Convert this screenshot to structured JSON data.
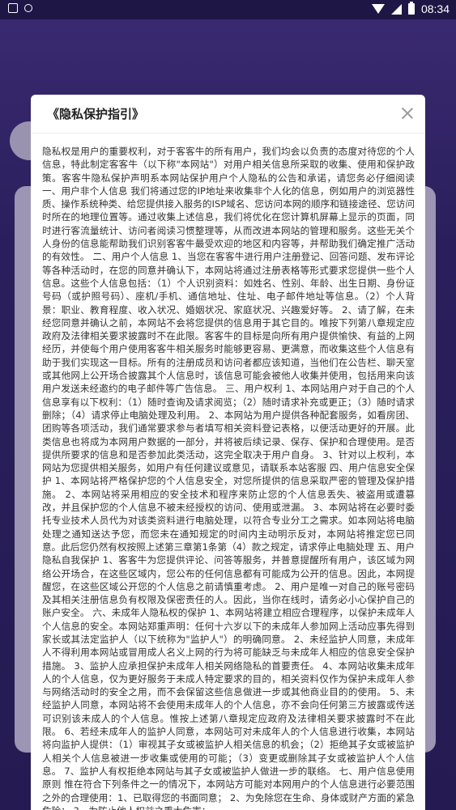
{
  "status_bar": {
    "time": "08:34",
    "icons": [
      "notification-icon",
      "sync-icon",
      "wifi-icon",
      "signal-icon",
      "battery-icon"
    ]
  },
  "dialog": {
    "title": "《隐私保护指引》",
    "close_icon": "close-icon",
    "body": "隐私权是用户的重要权利，对于客客牛的所有用户，我们均会以负责的态度对待您的个人信息，特此制定客客牛（以下称\"本网站\"）对用户相关信息所采取的收集、使用和保护政策。客客牛隐私保护声明系本网站保护用户个人隐私的公告和承诺，请您务必仔细阅读 一、用户非个人信息 我们将通过您的IP地址来收集非个人化的信息，例如用户的浏览器性质、操作系统种类、给您提供接入服务的ISP域名、您访问本网的顺序和链接途径、您访问时所在的地理位置等。通过收集上述信息，我们将优化在您计算机屏幕上显示的页面，同时进行客流量统计、访问者阅读习惯整理等，从而改进本网站的管理和服务。这些无关个人身份的信息能帮助我们识别客客牛最受欢迎的地区和内容等，并帮助我们确定推广活动的有效性。 二、用户个人信息 1、当您在客客牛进行用户注册登记、回答问题、发布评论等各种活动时，在您的同意并确认下，本网站将通过注册表格等形式要求您提供一些个人信息。这些个人信息包括：（1）个人识别资料：如姓名、性别、年龄、出生日期、身份证号码（或护照号码）、座机/手机、通信地址、住址、电子邮件地址等信息。（2）个人背景：职业、教育程度、收入状况、婚姻状况、家庭状况、兴趣爱好等。 2、请了解，在未经您同意并确认之前，本网站不会将您提供的信息用于其它目的。唯按下列第八章规定应政府及法律相关要求披露时不在此限。客客牛的目标是向所有用户提供愉快、有益的上网经历，并使每个用户使用客客牛相关服务时能够更容易、更满意，而收集这些个人信息有助于我们实现这一目标。所有的注册成员和访问者都应该知道，当他们在公告栏、聊天室或其他网上公开场合披露其个人信息时，该信息可能会被他人收集并使用，包括用来向该用户发送未经邀约的电子邮件等广告信息。 三、用户权利 1、本网站用户对于自己的个人信息享有以下权利：（1）随时查询及请求阅览；（2）随时请求补充或更正；（3）随时请求删除；（4）请求停止电脑处理及利用。 2、本网站为用户提供各种配套服务，如看房团、团购等各项活动，我们通常要求参与者填写相关资料登记表格，以便活动更好的开展。此类信息也将成为本网用户数据的一部分，并将被后续记录、保存、保护和合理使用。是否提供所要求的信息和是否参加此类活动，这完全取决于用户自身。 3、针对以上权利，本网站为您提供相关服务，如用户有任何建议或意见，请联系本站客服 四、用户信息安全保护 1、本网站将严格保护您的个人信息安全，对您所提供的信息采取严密的管理及保护措施。 2、本网站将采用相应的安全技术和程序来防止您的个人信息丢失、被盗用或遭篡改，并且保护您的个人信息不被未经授权的访问、使用或泄漏。 3、本网站将在必要时委托专业技术人员代为对该类资料进行电脑处理，以符合专业分工之需求。如本网站将电脑处理之通知送达予您，而您未在通知规定的时间内主动明示反对，本网站将推定您已同意。此后您仍然有权按照上述第三章第1条第（4）款之规定，请求停止电脑处理 五、用户隐私自我保护 1、客客牛为您提供评论、问答等服务，并普意提醒所有用户，该区域为网络公开场合，在这些区域内，您公布的任何信息都有可能成为公开的信息。因此，本网提醒您，在这些区域公开您的个人信息之前请慎重考虑。 2、用户是唯一对自己的账号密码及其相关注册信息负有权限及保密责任的人。因此，当你在线时，请务必小心保护自己的账户安全。 六、未成年人隐私权的保护 1、本网站将建立相应合理程序，以保护未成年人个人信息的安全。本网站郑重声明：任何十六岁以下的未成年人参加网上活动应事先得到家长或其法定监护人（以下统称为\"监护人\"）的明确同意。 2、未经监护人同意，未成年人不得利用本网站或冒用成人名义上网的行为将可能缺乏与未成年人相应的信息安全保护措施。 3、监护人应承担保护未成年人相关网络隐私的首要责任。 4、本网站收集未成年人的个人信息，仅为更好服务于未成人特定要求的目的，相关资料仅作为保护未成年人参与网络活动时的安全之用，而不会保留这些信息做进一步或其他商业目的的使用。 5、未经监护人同意，本网站将不会使用未成年人的个人信息，亦不会向任何第三方披露或传送可识别该未成人的个人信息。惟按上述第八章规定应政府及法律相关要求披露时不在此限。 6、若经未成年人的监护人同意，本网站可对未成年人的个人信息进行收集，本网站将向监护人提供：（1）审视其子女或被监护人相关信息的机会；（2）拒绝其子女或被监护人相关个人信息被进一步收集或使用的可能；（3）变更或删除其子女或被监护人个人信息。 7、监护人有权拒绝本网站与其子女或被监护人做进一步的联络。 七、用户信息使用原则 惟在符合下列条件之一的情况下，本网站方可能对本网用户的个人信息进行必要范围之外的合理使用：1、已取得您的书面同意； 2、为免除您在生命、身体或财产方面的紧急危险； 3、为防止他人权益之重大危害；"
  }
}
